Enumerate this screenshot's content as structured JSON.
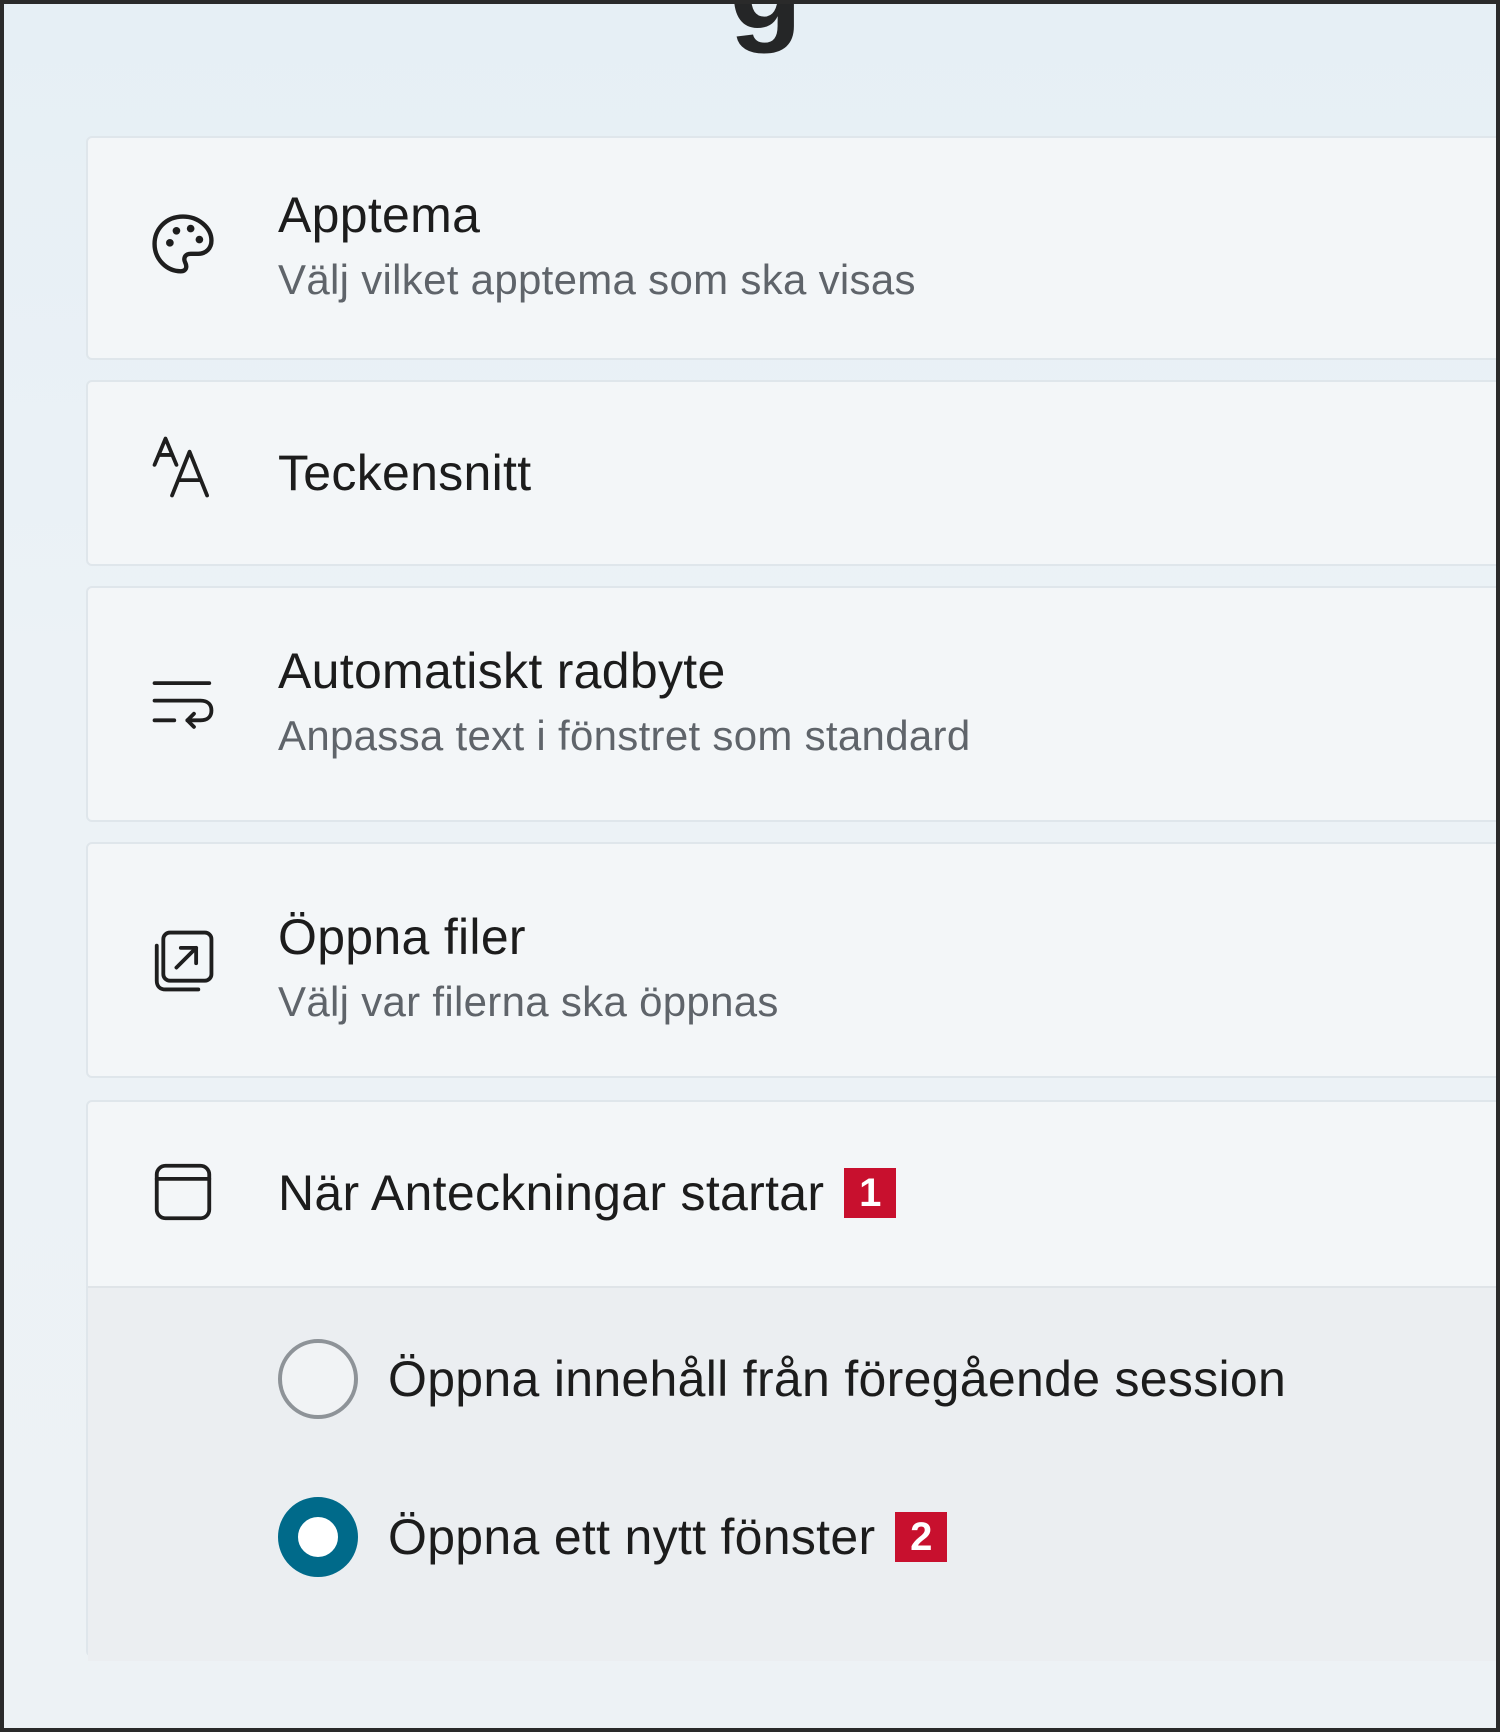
{
  "settings": {
    "items": [
      {
        "icon": "palette-icon",
        "title": "Apptema",
        "subtitle": "Välj vilket apptema som ska visas"
      },
      {
        "icon": "font-icon",
        "title": "Teckensnitt"
      },
      {
        "icon": "word-wrap-icon",
        "title": "Automatiskt radbyte",
        "subtitle": "Anpassa text i fönstret som standard"
      },
      {
        "icon": "open-external-icon",
        "title": "Öppna filer",
        "subtitle": "Välj var filerna ska öppnas"
      },
      {
        "icon": "window-icon",
        "title": "När Anteckningar startar",
        "badge": "1"
      }
    ],
    "startup_options": [
      {
        "label": "Öppna innehåll från föregående session",
        "selected": false
      },
      {
        "label": "Öppna ett nytt fönster",
        "selected": true,
        "badge": "2"
      }
    ]
  },
  "colors": {
    "accent": "#006a8a",
    "badge": "#c8102e"
  }
}
